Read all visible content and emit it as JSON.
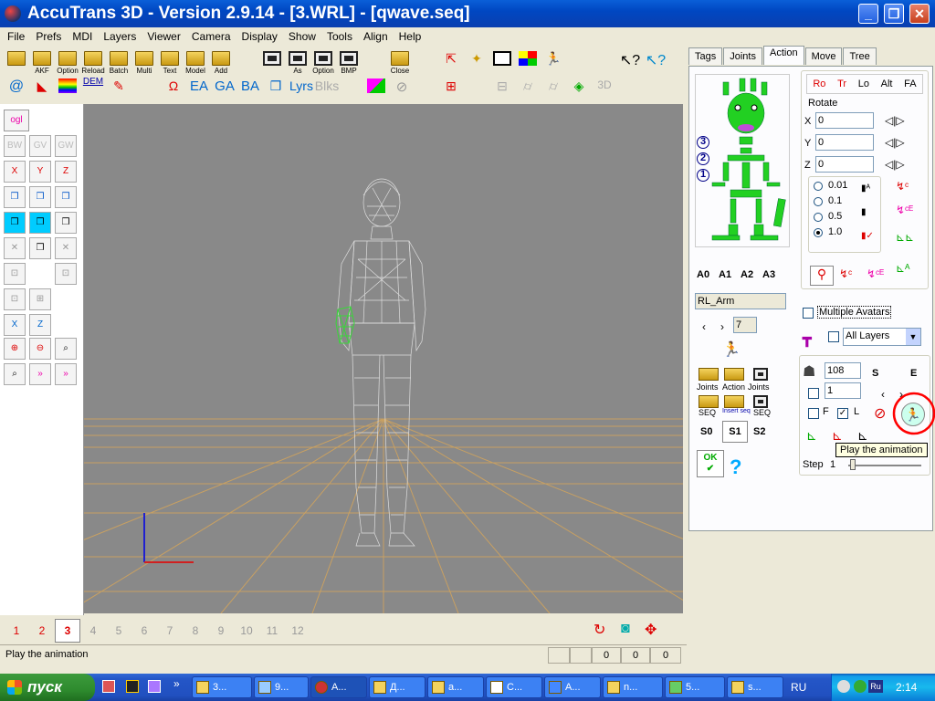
{
  "window": {
    "title": "AccuTrans 3D - Version 2.9.14 - [3.WRL] - [qwave.seq]"
  },
  "menu": [
    "File",
    "Prefs",
    "MDI",
    "Layers",
    "Viewer",
    "Camera",
    "Display",
    "Show",
    "Tools",
    "Align",
    "Help"
  ],
  "toolbar": {
    "row1": [
      {
        "label": "AKF",
        "icon": "open-akf-icon"
      },
      {
        "label": "Option",
        "icon": "open-option-icon"
      },
      {
        "label": "Reload",
        "icon": "reload-icon"
      },
      {
        "label": "Batch",
        "icon": "batch-icon"
      },
      {
        "label": "Multi",
        "icon": "multi-icon"
      },
      {
        "label": "Text",
        "icon": "text-icon"
      },
      {
        "label": "Model",
        "icon": "model-icon"
      },
      {
        "label": "Add",
        "icon": "add-icon"
      }
    ],
    "save_as_label": "As",
    "save_option_label": "Option",
    "save_bmp_label": "BMP",
    "close_label": "Close",
    "row2_labels": {
      "dem": "DEM",
      "ea": "EA",
      "ga": "GA",
      "ba": "BA",
      "lyrs": "Lyrs",
      "blks": "Blks",
      "threed": "3D"
    }
  },
  "left_tools": {
    "ogl": "ogl",
    "bw": "BW",
    "gv": "GV",
    "gw": "GW",
    "rx": "X",
    "ry": "Y",
    "rz": "Z",
    "xs": "X",
    "zs": "Z"
  },
  "bottom": {
    "numbers": [
      "1",
      "2",
      "3",
      "4",
      "5",
      "6",
      "7",
      "8",
      "9",
      "10",
      "11",
      "12"
    ],
    "selected": "3"
  },
  "status": {
    "text": "Play the animation",
    "values": [
      "0",
      "0",
      "0"
    ]
  },
  "right_panel": {
    "tabs": [
      "Tags",
      "Joints",
      "Action",
      "Move",
      "Tree"
    ],
    "active_tab": "Action",
    "level_labels": [
      "3",
      "2",
      "1"
    ],
    "avatar_buttons": [
      "A0",
      "A1",
      "A2",
      "A3"
    ],
    "joint_name": "RL_Arm",
    "nav_value": "7",
    "modes": [
      "Ro",
      "Tr",
      "Lo",
      "Alt",
      "FA"
    ],
    "rotate_title": "Rotate",
    "rotate": {
      "x_label": "X",
      "x": "0",
      "y_label": "Y",
      "y": "0",
      "z_label": "Z",
      "z": "0"
    },
    "steps": [
      "0.01",
      "0.1",
      "0.5",
      "1.0"
    ],
    "selected_step": "1.0",
    "file_buttons": [
      {
        "top": "Joints",
        "bottom": "Action"
      },
      {
        "label": "Joints"
      },
      {
        "label": "SEQ"
      },
      {
        "label": "SEQ"
      }
    ],
    "load_labels": [
      "Joints",
      "Action",
      "Joints"
    ],
    "seq_labels": [
      "SEQ",
      "Insert seq",
      "SEQ"
    ],
    "s_buttons": [
      "S0",
      "S1",
      "S2"
    ],
    "ok_label": "OK",
    "help_label": "?",
    "multiple_avatars_label": "Multiple Avatars",
    "layers_select": "All Layers",
    "frames_value": "108",
    "frame_value": "1",
    "s_label": "S",
    "e_label": "E",
    "f_label": "F",
    "l_label": "L",
    "step_label": "Step",
    "step_value": "1",
    "tooltip": "Play the animation"
  },
  "taskbar": {
    "start": "пуск",
    "tasks": [
      "3...",
      "9...",
      "A...",
      "Д...",
      "a...",
      "C...",
      "A...",
      "n...",
      "5...",
      "s..."
    ],
    "lang": "RU",
    "clock": "2:14"
  },
  "colors": {
    "titlebar": "#0a5fd8",
    "viewport": "#898989",
    "grid": "#c8a062",
    "wire": "#d8d8d8",
    "selected_arm": "#3ad63a",
    "skeleton": "#22d022",
    "red_circle": "#ff0000"
  }
}
